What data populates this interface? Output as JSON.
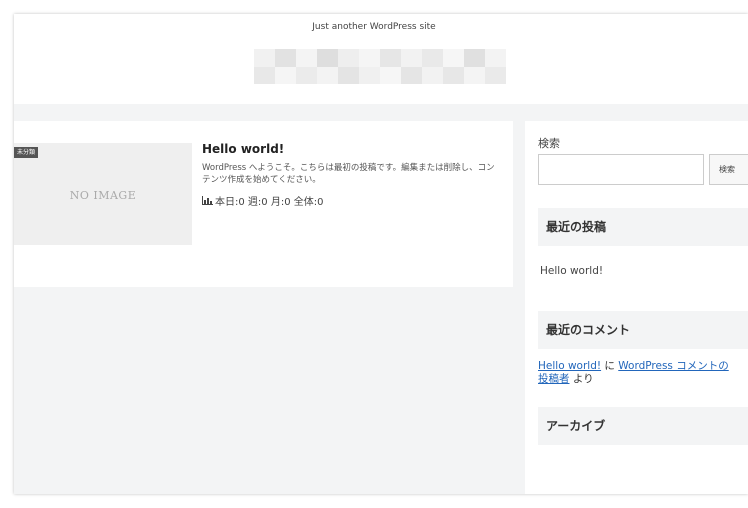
{
  "header": {
    "tagline": "Just another WordPress site",
    "logo_mosaic": [
      "#f1f1f1",
      "#e2e2e2",
      "#f4f4f4",
      "#dedede",
      "#eeeeee",
      "#f5f5f5",
      "#e6e6e6",
      "#f2f2f2",
      "#e9e9e9",
      "#f6f6f6",
      "#e0e0e0",
      "#f3f3f3",
      "#e8e8e8",
      "#f5f5f5",
      "#ebebeb",
      "#f3f3f3",
      "#e4e4e4",
      "#f0f0f0",
      "#f6f6f6",
      "#e5e5e5",
      "#f2f2f2",
      "#e7e7e7",
      "#f4f4f4",
      "#eaeaea"
    ]
  },
  "post": {
    "category": "未分類",
    "no_image": "NO IMAGE",
    "title": "Hello world!",
    "excerpt": "WordPress へようこそ。こちらは最初の投稿です。編集または削除し、コンテンツ作成を始めてください。",
    "views": "本日:0 週:0 月:0 全体:0"
  },
  "sidebar": {
    "search_label": "検索",
    "search_placeholder": "",
    "search_button": "検索",
    "recent_posts_title": "最近の投稿",
    "recent_posts": [
      "Hello world!"
    ],
    "recent_comments_title": "最近のコメント",
    "comment": {
      "post_link": "Hello world!",
      "connector": " に ",
      "author_link_1": "WordPress コメントの",
      "author_link_2": "投稿者",
      "suffix": " より"
    },
    "archives_title": "アーカイブ"
  },
  "colors": {
    "background": "#f3f4f5",
    "link": "#2266bb",
    "badge": "#555555"
  }
}
